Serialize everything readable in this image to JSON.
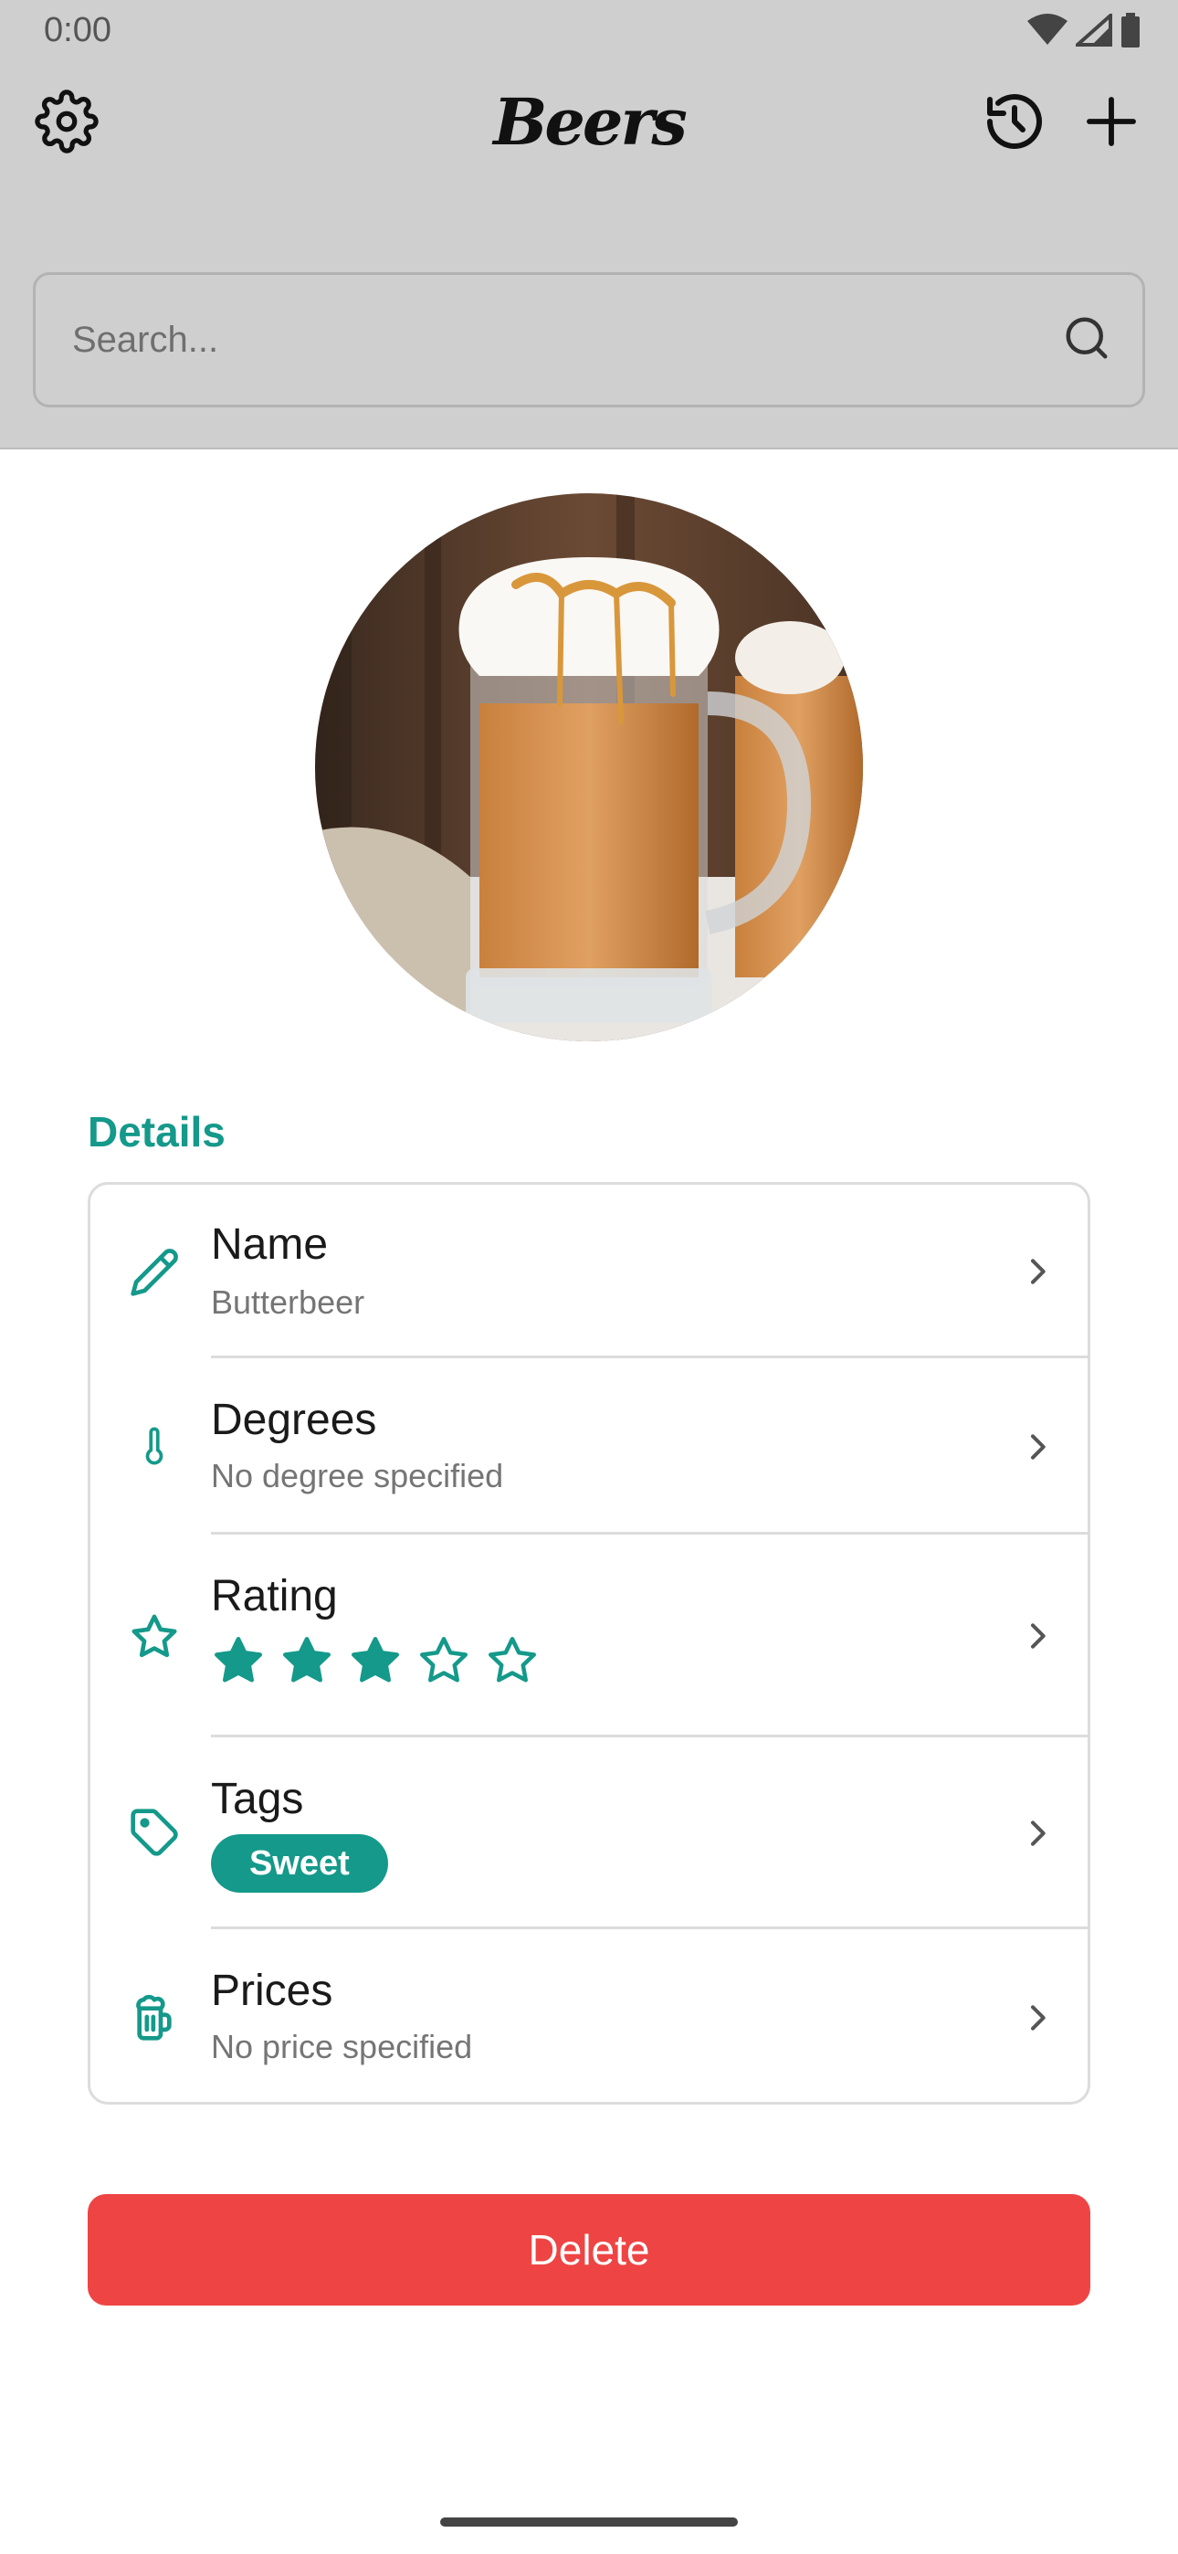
{
  "status_bar": {
    "time": "0:00"
  },
  "app_bar": {
    "title": "Beers",
    "icons": [
      "gear-icon",
      "history-icon",
      "plus-icon"
    ]
  },
  "search": {
    "placeholder": "Search..."
  },
  "photo": {
    "subject": "beer-mug-photo"
  },
  "details": {
    "section_title": "Details",
    "name": {
      "label": "Name",
      "value": "Butterbeer"
    },
    "degrees": {
      "label": "Degrees",
      "value": "No degree specified"
    },
    "rating": {
      "label": "Rating",
      "value": 3,
      "max": 5
    },
    "tags": {
      "label": "Tags",
      "items": [
        "Sweet"
      ]
    },
    "prices": {
      "label": "Prices",
      "value": "No price specified"
    }
  },
  "delete_button": {
    "label": "Delete"
  },
  "colors": {
    "accent": "#14998a",
    "danger": "#ef4444",
    "top_background": "#cfcfcf"
  }
}
